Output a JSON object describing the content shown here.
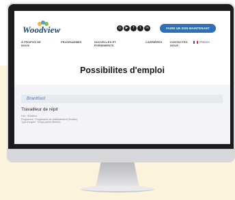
{
  "site": {
    "logo_text": "Woodview",
    "logo_colors": [
      "#f3b52a",
      "#4a9fd8",
      "#7bbf4e",
      "#e05a3b"
    ],
    "donate_label": "FAIRE UN DON MAINTENANT",
    "social_icons": [
      "instagram-icon",
      "youtube-icon",
      "facebook-icon",
      "twitter-icon",
      "linkedin-icon"
    ],
    "social_glyphs": [
      "◎",
      "▶",
      "f",
      "t",
      "in"
    ]
  },
  "nav": {
    "items": [
      {
        "label": "À PROPOS DE\nNOUS"
      },
      {
        "label": "PROGRAMMES"
      },
      {
        "label": "NOUVELLES ET\nÉVÉNEMENTS"
      },
      {
        "label": "CARRIÈRES"
      },
      {
        "label": "CONTACTEZ-\nNOUS"
      }
    ],
    "language": "FRENCH"
  },
  "page": {
    "heading": "Possibilites d'emploi"
  },
  "listing": {
    "section": "Brantford",
    "job_title": "Travailleur de répit",
    "meta": [
      "Lieu : Brantford",
      "Programme : Programmes de rétablissement (Soutien)",
      "Type d'emploi : Temps partiel (Relève)"
    ]
  }
}
